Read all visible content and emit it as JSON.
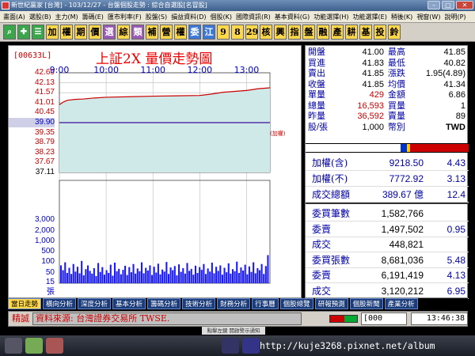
{
  "window": {
    "title": "新世紀贏家 [台灣] - 103/12/27 - 台盤個股走勢 : 綜合自選股[名冒股]",
    "min": "–",
    "max": "□",
    "close": "✕"
  },
  "menu": [
    "畫面(A)",
    "選股(B)",
    "主力(M)",
    "籌碼(E)",
    "匯市利率(F)",
    "股盤(S)",
    "損益資料(D)",
    "個股(K)",
    "國際資訊(R)",
    "基本資料(G)",
    "功能選擇(H)",
    "功能選擇(E)",
    "稍後(K)",
    "視窗(W)",
    "說明(P)"
  ],
  "toolbar": [
    "加",
    "權",
    "期",
    "價",
    "選",
    "綜",
    "類",
    "補",
    "營",
    "權",
    "委",
    "江",
    "9",
    "8",
    "29",
    "核",
    "興",
    "指",
    "盤",
    "融",
    "產",
    "耕",
    "基",
    "投",
    "鈴"
  ],
  "chart": {
    "symbol": "[00633L]",
    "title": "上証2X 量價走勢圖",
    "ref_note": "(加權)",
    "price_ticks": [
      "42.69",
      "42.13",
      "41.57",
      "41.01",
      "40.45",
      "39.90",
      "39.35",
      "38.79",
      "38.23",
      "37.67",
      "37.11"
    ],
    "ref_price_label": "39.90",
    "volume_ticks": [
      "3,000",
      "2,000",
      "1,000",
      "500",
      "100",
      "50",
      "15",
      "張"
    ],
    "time_labels": [
      "9:00",
      "10:00",
      "11:00",
      "12:00",
      "13:00"
    ]
  },
  "chart_data": {
    "type": "line",
    "x_unit": "time",
    "x": [
      "09:00",
      "09:05",
      "09:10",
      "09:20",
      "09:30",
      "09:45",
      "10:00",
      "10:30",
      "11:00",
      "11:30",
      "12:00",
      "12:15",
      "12:30",
      "13:00",
      "13:15",
      "13:30"
    ],
    "y": [
      40.9,
      41.05,
      41.15,
      41.2,
      41.22,
      41.28,
      41.32,
      41.35,
      41.38,
      41.4,
      41.42,
      41.5,
      41.6,
      41.7,
      41.8,
      41.85
    ],
    "ylim": [
      37.11,
      42.69
    ],
    "reference_price": 39.9,
    "volume_ylim": [
      0,
      3000
    ],
    "volumes": [
      520,
      380,
      610,
      300,
      450,
      270,
      560,
      340,
      480,
      290,
      650,
      230,
      410,
      520,
      360,
      280,
      440,
      210,
      590,
      330,
      470,
      250,
      380,
      300,
      540,
      220,
      600,
      350,
      420,
      260,
      390,
      510,
      240,
      470,
      320,
      560,
      280,
      430,
      350,
      610,
      290,
      450,
      370,
      520,
      240,
      480,
      310,
      570,
      260,
      400,
      340,
      620,
      270,
      460,
      380,
      500,
      230,
      550,
      330,
      440,
      280,
      590,
      360,
      420,
      250,
      510,
      300,
      470,
      390,
      560,
      270,
      430,
      340,
      600,
      290,
      480,
      360,
      520,
      250,
      450,
      320,
      580,
      280,
      410,
      350,
      630,
      300,
      460,
      370,
      540,
      260,
      490,
      330,
      610,
      290,
      440,
      380,
      560,
      270,
      500,
      820
    ]
  },
  "quote": {
    "rows": [
      {
        "l1": "開盤",
        "v1": "41.00",
        "l2": "最高",
        "v2": "41.85"
      },
      {
        "l1": "買進",
        "v1": "41.83",
        "l2": "最低",
        "v2": "40.82"
      },
      {
        "l1": "賣出",
        "v1": "41.85",
        "l2": "漲跌",
        "v2": "1.95(4.89)"
      },
      {
        "l1": "收盤",
        "v1": "41.85",
        "l2": "均價",
        "v2": "41.34"
      },
      {
        "l1": "單量",
        "v1": "429",
        "l2": "金額",
        "v2": "6.86"
      },
      {
        "l1": "總量",
        "v1": "16,593",
        "l2": "買量",
        "v2": "1"
      },
      {
        "l1": "昨量",
        "v1": "36,592",
        "l2": "賣量",
        "v2": "89"
      },
      {
        "l1": "股/張",
        "v1": "1,000",
        "l2": "幣別",
        "v2": "TWD"
      }
    ],
    "market": [
      {
        "label": "加權(含)",
        "value": "9218.50",
        "pct": "4.43"
      },
      {
        "label": "加權(不)",
        "value": "7772.92",
        "pct": "3.13"
      },
      {
        "label": "成交總額",
        "value": "389.67 億",
        "pct": "12.4"
      }
    ],
    "orders": [
      {
        "label": "委買筆數",
        "value": "1,582,766",
        "pct": ""
      },
      {
        "label": "委賣",
        "value": "1,497,502",
        "pct": "0.95"
      },
      {
        "label": "成交",
        "value": "448,821",
        "pct": ""
      },
      {
        "label": "委買張數",
        "value": "8,681,036",
        "pct": "5.48"
      },
      {
        "label": "委賣",
        "value": "6,191,419",
        "pct": "4.13"
      },
      {
        "label": "成交",
        "value": "3,120,212",
        "pct": "6.95"
      }
    ],
    "colors": {
      "up": "#cc0000",
      "down": "#0000cc",
      "neutral": "#000000"
    }
  },
  "tabs": [
    "當日走勢",
    "橫向分析",
    "深度分析",
    "基本分析",
    "籌碼分析",
    "技術分析",
    "財務分析",
    "行事曆",
    "個股總覽",
    "研報預測",
    "個股新聞",
    "產業分析"
  ],
  "status": {
    "lead": "精誠",
    "source": "資料來源: 台灣證券交易所 TWSE.",
    "code": "[000",
    "time": "13:46:38"
  },
  "notice": "點擊左鍵 開啟警示通知",
  "url": "http://kuje3268.pixnet.net/album"
}
